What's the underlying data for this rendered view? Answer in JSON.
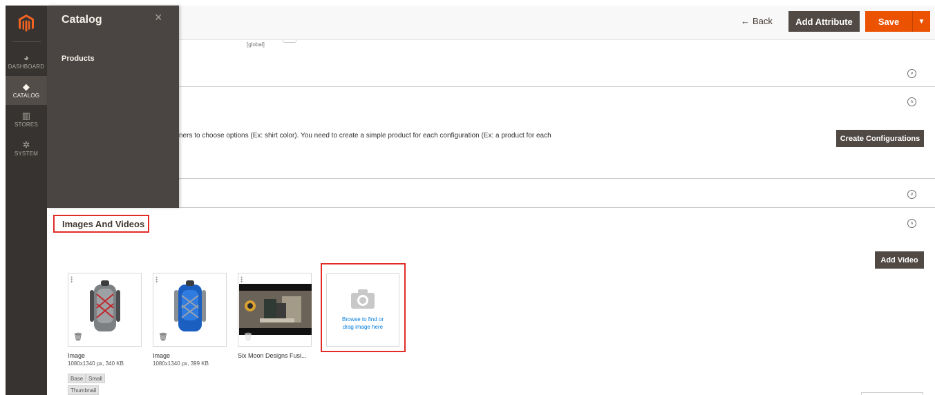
{
  "admin_menu": {
    "items": [
      {
        "label": "DASHBOARD",
        "icon": "dashboard-icon"
      },
      {
        "label": "CATALOG",
        "icon": "catalog-icon"
      },
      {
        "label": "STORES",
        "icon": "stores-icon"
      },
      {
        "label": "SYSTEM",
        "icon": "system-icon"
      }
    ],
    "active": "CATALOG"
  },
  "flyout": {
    "title": "Catalog",
    "close_icon": "×",
    "links": [
      "Products"
    ]
  },
  "header": {
    "back_label": "Back",
    "back_arrow": "←",
    "add_attribute_label": "Add Attribute",
    "save_label": "Save",
    "save_toggle": "▼"
  },
  "scope": {
    "label": "[global]"
  },
  "configurations": {
    "text": "ners to choose options (Ex: shirt color). You need to create a simple product for each configuration (Ex: a product for each",
    "button_label": "Create Configurations"
  },
  "images_section": {
    "title": "Images And Videos",
    "add_video_label": "Add Video",
    "items": [
      {
        "title": "Image",
        "meta": "1080x1340 px, 340 KB",
        "roles": [
          "Base",
          "Small",
          "Thumbnail"
        ]
      },
      {
        "title": "Image",
        "meta": "1080x1340 px, 399 KB",
        "roles": []
      },
      {
        "title": "Six Moon Designs Fusi...",
        "meta": "",
        "roles": []
      }
    ],
    "upload_text_line1": "Browse to find or",
    "upload_text_line2": "drag image here"
  },
  "colors": {
    "menu_bg": "#373330",
    "flyout_bg": "#4a4542",
    "primary_orange": "#eb5202",
    "dark_button": "#514943",
    "highlight_red": "#e02b27",
    "link_blue": "#007bdb"
  }
}
